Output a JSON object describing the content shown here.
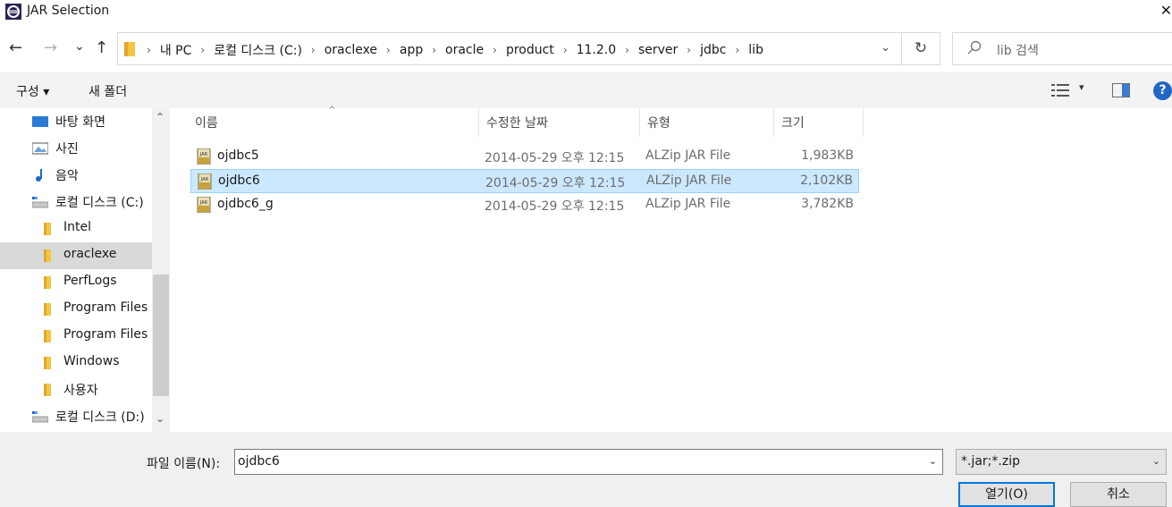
{
  "window": {
    "title": "JAR Selection",
    "close_glyph": "✕"
  },
  "nav": {
    "back_glyph": "←",
    "forward_glyph": "→",
    "recent_glyph": "⌄",
    "up_glyph": "↑",
    "breadcrumbs": [
      "내 PC",
      "로컬 디스크 (C:)",
      "oraclexe",
      "app",
      "oracle",
      "product",
      "11.2.0",
      "server",
      "jdbc",
      "lib"
    ],
    "separator": "›",
    "dropdown_glyph": "⌄",
    "refresh_glyph": "↻",
    "search_placeholder": "lib 검색"
  },
  "toolbar": {
    "organize_label": "구성 ▾",
    "new_folder_label": "새 폴더",
    "view_dropdown_glyph": "▾",
    "help_label": "?"
  },
  "sidebar": {
    "items": [
      {
        "label": "바탕 화면",
        "icon": "desktop-icon"
      },
      {
        "label": "사진",
        "icon": "pictures-icon"
      },
      {
        "label": "음악",
        "icon": "music-icon"
      },
      {
        "label": "로컬 디스크 (C:)",
        "icon": "drive-icon"
      },
      {
        "label": "Intel",
        "icon": "folder-icon"
      },
      {
        "label": "oraclexe",
        "icon": "folder-icon",
        "selected": true
      },
      {
        "label": "PerfLogs",
        "icon": "folder-icon"
      },
      {
        "label": "Program Files",
        "icon": "folder-icon"
      },
      {
        "label": "Program Files (",
        "icon": "folder-icon"
      },
      {
        "label": "Windows",
        "icon": "folder-icon"
      },
      {
        "label": "사용자",
        "icon": "folder-icon"
      },
      {
        "label": "로컬 디스크 (D:)",
        "icon": "drive-icon"
      }
    ],
    "scroll_up_glyph": "⌃",
    "scroll_down_glyph": "⌄"
  },
  "filelist": {
    "columns": {
      "name": "이름",
      "date": "수정한 날짜",
      "type": "유형",
      "size": "크기"
    },
    "sort_glyph": "^",
    "rows": [
      {
        "name": "ojdbc5",
        "date": "2014-05-29 오후 12:15",
        "type": "ALZip JAR File",
        "size": "1,983KB"
      },
      {
        "name": "ojdbc6",
        "date": "2014-05-29 오후 12:15",
        "type": "ALZip JAR File",
        "size": "2,102KB",
        "selected": true
      },
      {
        "name": "ojdbc6_g",
        "date": "2014-05-29 오후 12:15",
        "type": "ALZip JAR File",
        "size": "3,782KB"
      }
    ]
  },
  "footer": {
    "filename_label": "파일 이름(N):",
    "filename_value": "ojdbc6",
    "filter_value": "*.jar;*.zip",
    "dropdown_glyph": "⌄",
    "open_label": "열기(O)",
    "cancel_label": "취소"
  },
  "colors": {
    "accent": "#0078d7",
    "selection": "#cce8ff",
    "folder": "#f4c542"
  }
}
